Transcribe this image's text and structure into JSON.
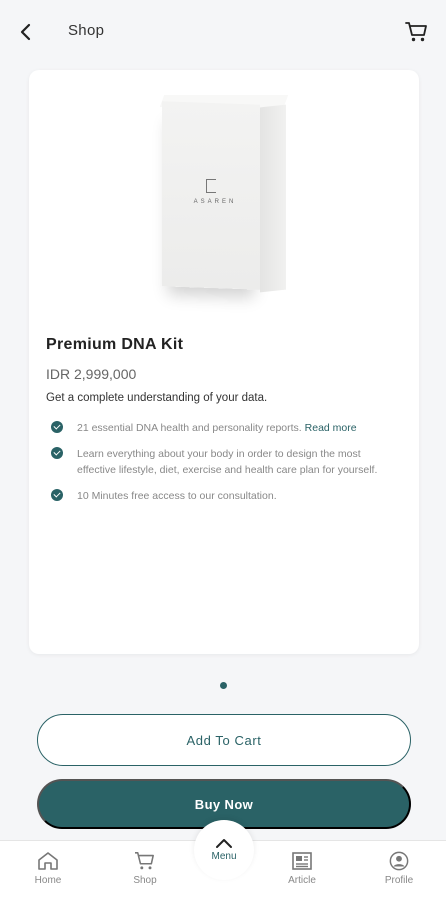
{
  "header": {
    "title": "Shop",
    "back_icon": "chevron-left-icon",
    "cart_icon": "cart-icon"
  },
  "product": {
    "brand_on_box": "ASAREN",
    "name": "Premium DNA Kit",
    "price": "IDR 2,999,000",
    "tagline": "Get a complete understanding of your data.",
    "features": [
      {
        "text": "21 essential DNA health and personality reports.",
        "link": "Read more"
      },
      {
        "text": "Learn everything about your body in order to design the most effective lifestyle, diet, exercise and health care plan for yourself."
      },
      {
        "text": "10 Minutes free access to our consultation."
      }
    ]
  },
  "carousel": {
    "current_page": 1,
    "total_pages": 1
  },
  "actions": {
    "add_to_cart": "Add To Cart",
    "buy_now": "Buy Now"
  },
  "bottom_nav": {
    "items": [
      {
        "label": "Home",
        "icon": "home-icon"
      },
      {
        "label": "Shop",
        "icon": "cart-icon"
      },
      {
        "label": "Menu",
        "icon": "chevron-up-icon"
      },
      {
        "label": "Article",
        "icon": "newspaper-icon"
      },
      {
        "label": "Profile",
        "icon": "profile-icon"
      }
    ]
  },
  "colors": {
    "accent": "#2a6266",
    "background": "#f5f6f8"
  }
}
